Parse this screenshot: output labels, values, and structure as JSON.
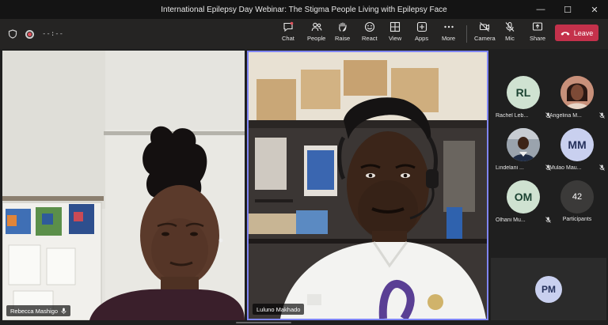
{
  "window": {
    "title": "International Epilepsy Day Webinar: The Stigma People Living with Epilepsy Face",
    "minimize": "—",
    "maximize": "☐",
    "close": "✕"
  },
  "meeting": {
    "timer": "--:--"
  },
  "toolbar": {
    "items": [
      {
        "label": "Chat",
        "icon": "chat-icon"
      },
      {
        "label": "People",
        "icon": "people-icon"
      },
      {
        "label": "Raise",
        "icon": "raise-hand-icon"
      },
      {
        "label": "React",
        "icon": "react-icon"
      },
      {
        "label": "View",
        "icon": "view-icon"
      },
      {
        "label": "Apps",
        "icon": "apps-icon"
      },
      {
        "label": "More",
        "icon": "more-icon"
      },
      {
        "label": "Camera",
        "icon": "camera-off-icon"
      },
      {
        "label": "Mic",
        "icon": "mic-off-icon"
      },
      {
        "label": "Share",
        "icon": "share-icon"
      }
    ],
    "leave_label": "Leave"
  },
  "stage": {
    "left_name": "Rebecca Mashigo",
    "right_name": "Luluno Makhado"
  },
  "roster": {
    "participants": [
      {
        "initials": "RL",
        "name": "Rachel Leb...",
        "photo": false,
        "bg": "#cfe2d1",
        "fg": "#1b4332"
      },
      {
        "initials": "",
        "name": "Angelina M...",
        "photo": true
      },
      {
        "initials": "",
        "name": "Lindelani ...",
        "photo": true
      },
      {
        "initials": "MM",
        "name": "Mulao Mau...",
        "photo": false,
        "bg": "#c9d0ef",
        "fg": "#25315c"
      },
      {
        "initials": "OM",
        "name": "Olhani Mu...",
        "photo": false,
        "bg": "#cfe2d1",
        "fg": "#1b4332"
      }
    ],
    "overflow_count": "42",
    "overflow_label": "Participants"
  },
  "self": {
    "initials": "PM"
  },
  "colors": {
    "leave": "#c4314b",
    "active_speaker": "#7f85f5",
    "toolbar": "#252423"
  }
}
